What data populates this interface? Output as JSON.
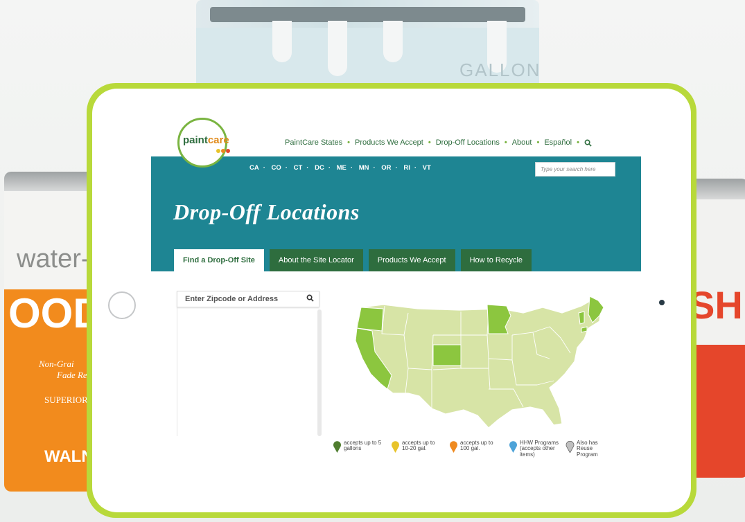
{
  "background": {
    "can_top_text": "GALLON",
    "can_left_text_1": "water-p",
    "can_left_text_2": "OOD",
    "can_left_text_3": "Non-Grai",
    "can_left_text_4": "Fade Re",
    "can_left_text_5": "SUPERIOR",
    "can_left_text_6": "WALN",
    "can_right_text": "SH"
  },
  "site": {
    "logo_part1": "paint",
    "logo_part2": "care",
    "nav": [
      "PaintCare States",
      "Products We Accept",
      "Drop-Off Locations",
      "About",
      "Español"
    ],
    "states": [
      "CA",
      "CO",
      "CT",
      "DC",
      "ME",
      "MN",
      "OR",
      "RI",
      "VT"
    ],
    "search_placeholder": "Type your search here",
    "page_title": "Drop-Off Locations",
    "tabs": [
      "Find a Drop-Off Site",
      "About the Site Locator",
      "Products We Accept",
      "How to Recycle"
    ],
    "zip_placeholder": "Enter Zipcode or Address",
    "legend": [
      {
        "label": "accepts up to 5 gallons",
        "color": "#4f7d2f"
      },
      {
        "label": "accepts up to 10-20 gal.",
        "color": "#e8c32b"
      },
      {
        "label": "accepts up to 100 gal.",
        "color": "#ef8a20"
      },
      {
        "label": "HHW Programs (accepts other items)",
        "color": "#4da3d8"
      },
      {
        "label": "Also has Reuse Program",
        "color": "#bfbfbf"
      }
    ]
  },
  "colors": {
    "teal": "#1e8593",
    "dark_green": "#2e6d3e",
    "light_green": "#7ab441",
    "map_base": "#d7e4a6",
    "map_highlight": "#8cc63f"
  }
}
